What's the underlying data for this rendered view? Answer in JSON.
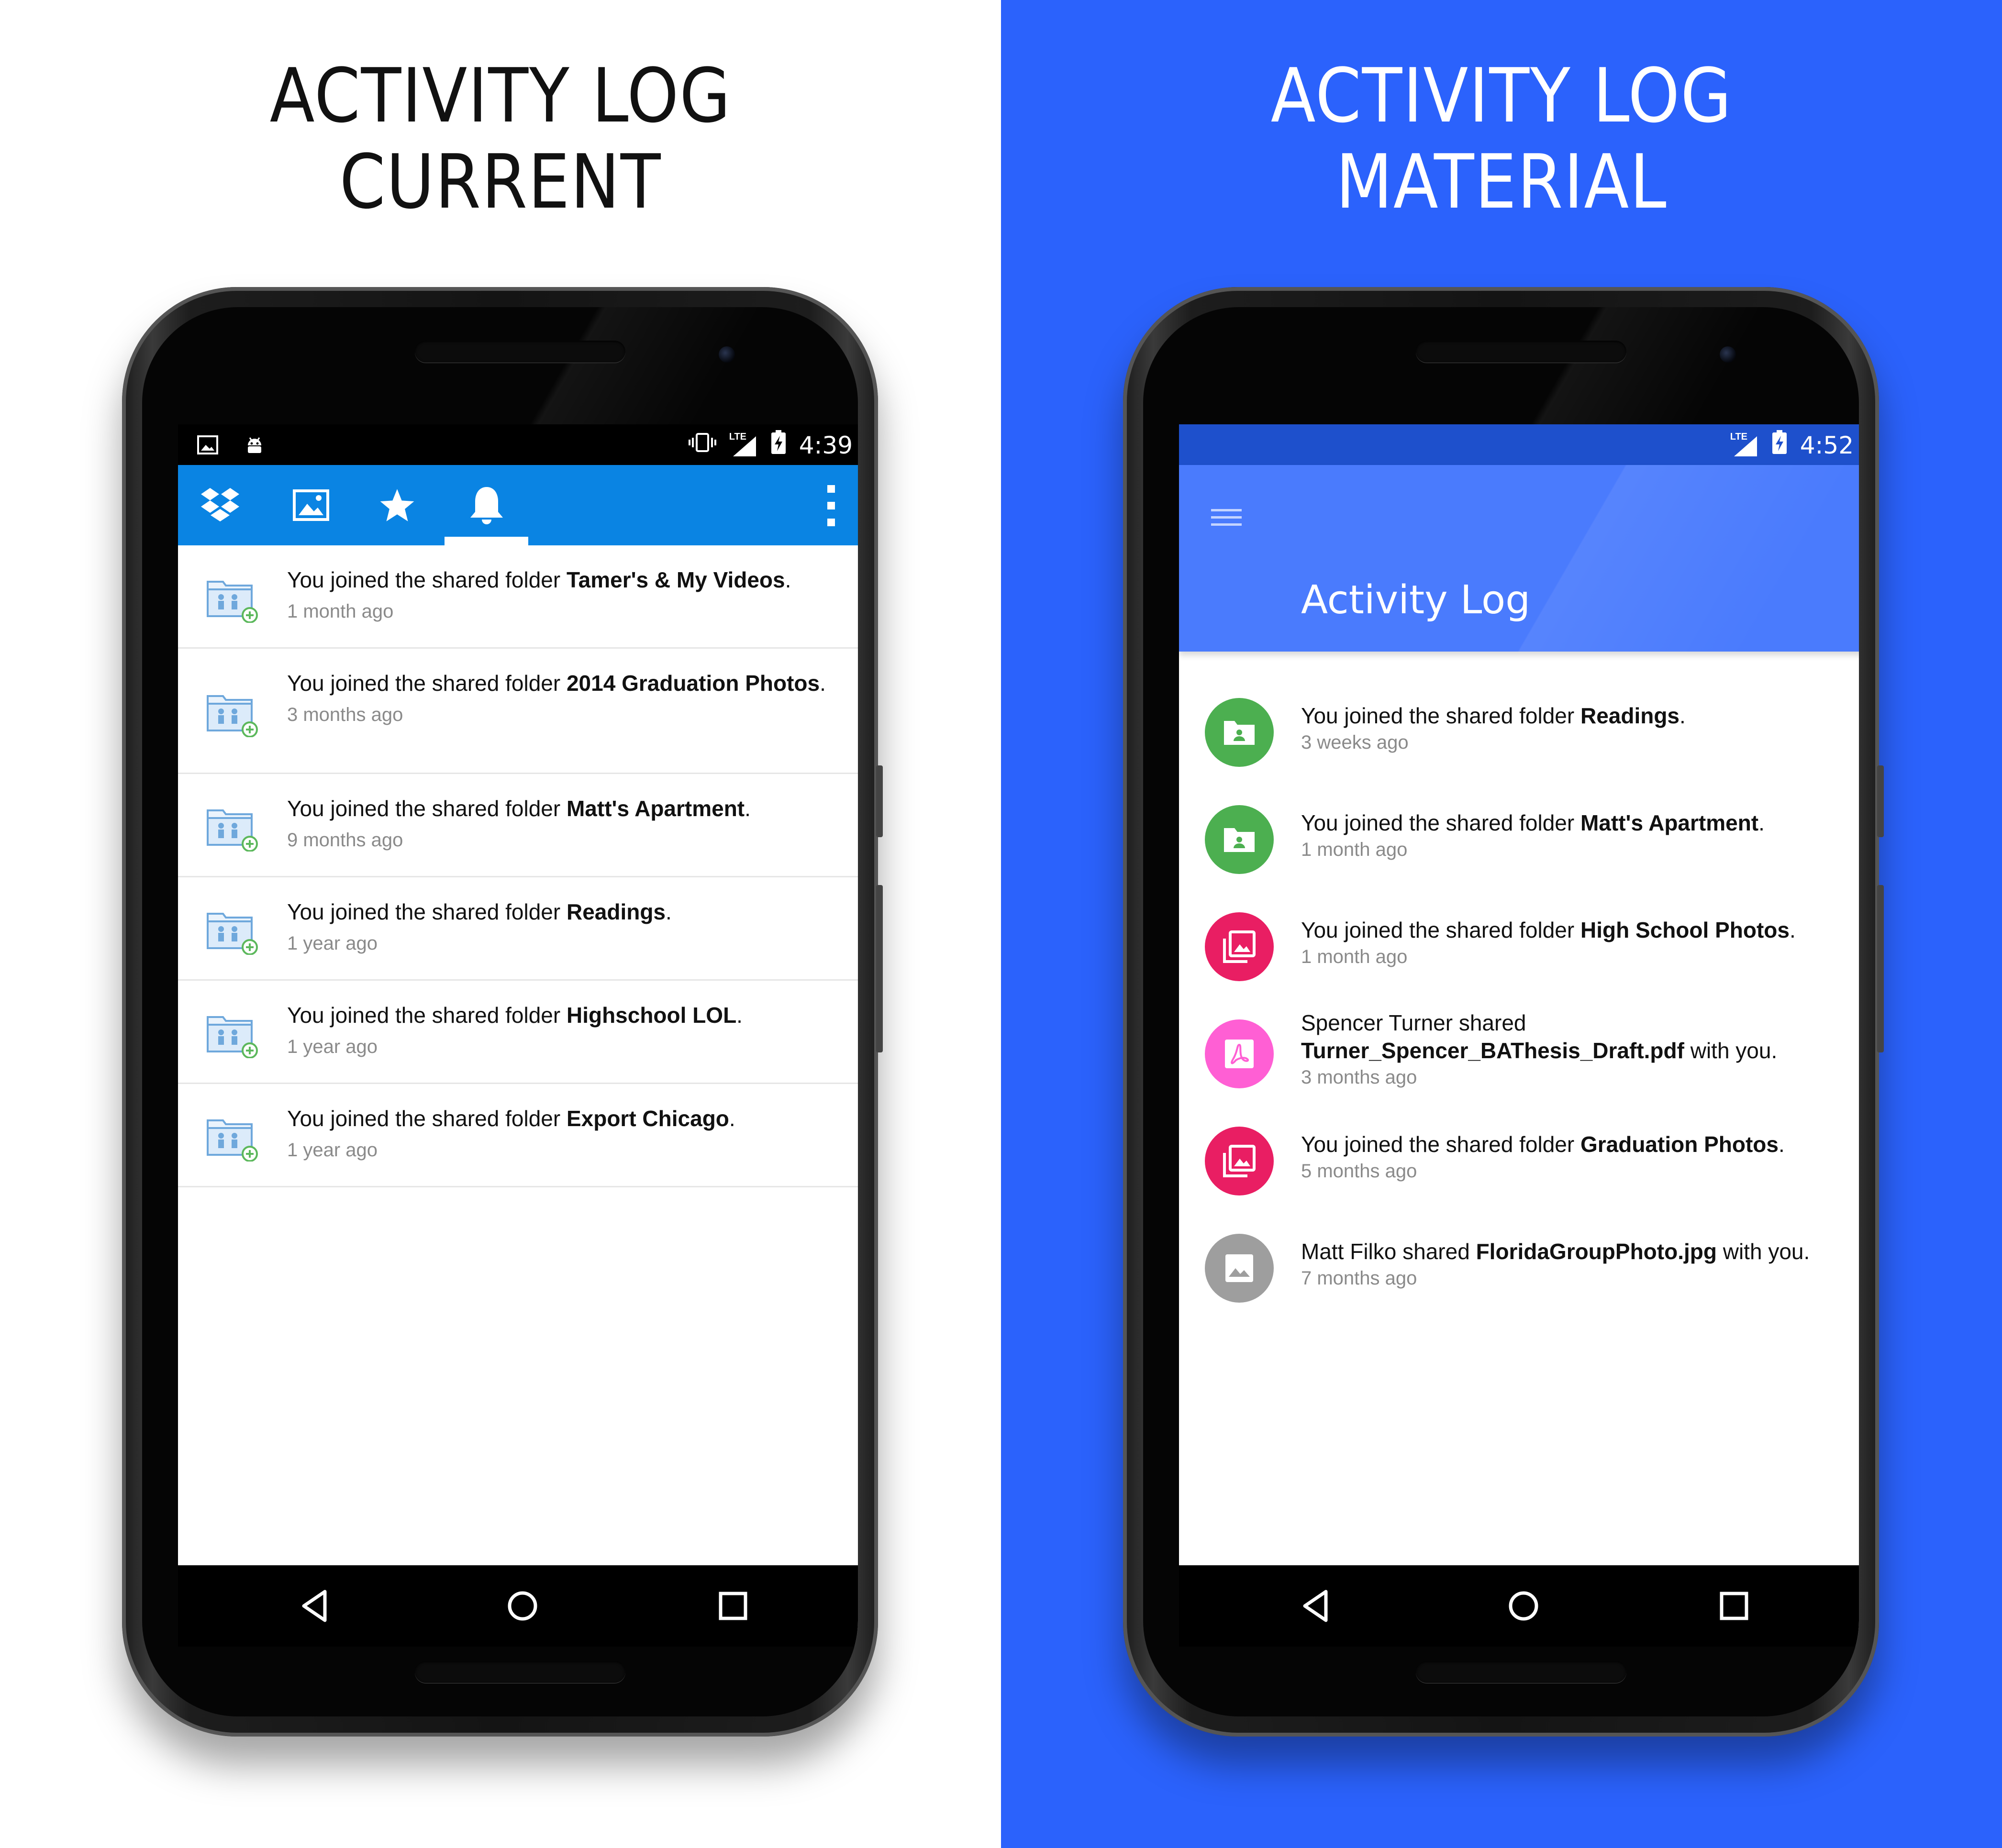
{
  "left": {
    "headline": [
      "ACTIVITY LOG",
      "CURRENT"
    ],
    "status_time": "4:39",
    "status_network": "LTE",
    "tabs": [
      {
        "icon": "dropbox-icon"
      },
      {
        "icon": "photos-icon"
      },
      {
        "icon": "star-icon"
      },
      {
        "icon": "bell-icon",
        "active": true
      }
    ],
    "items": [
      {
        "prefix": "You joined the shared folder ",
        "name": "Tamer's & My Videos",
        "suffix": ".",
        "time": "1 month ago"
      },
      {
        "prefix": "You joined the shared folder ",
        "name": "2014 Graduation Photos",
        "suffix": ".",
        "time": "3 months ago"
      },
      {
        "prefix": "You joined the shared folder ",
        "name": "Matt's Apartment",
        "suffix": ".",
        "time": "9 months ago"
      },
      {
        "prefix": "You joined the shared folder ",
        "name": "Readings",
        "suffix": ".",
        "time": "1 year ago"
      },
      {
        "prefix": "You joined the shared folder ",
        "name": "Highschool LOL",
        "suffix": ".",
        "time": "1 year ago"
      },
      {
        "prefix": "You joined the shared folder ",
        "name": "Export Chicago",
        "suffix": ".",
        "time": "1 year ago"
      }
    ]
  },
  "right": {
    "headline": [
      "ACTIVITY LOG",
      "MATERIAL"
    ],
    "status_time": "4:52",
    "status_network": "LTE",
    "title": "Activity Log",
    "items": [
      {
        "icon": "shared-folder-icon",
        "color": "#4caf50",
        "prefix": "You joined the shared folder ",
        "name": "Readings",
        "suffix": ".",
        "time": "3 weeks ago"
      },
      {
        "icon": "shared-folder-icon",
        "color": "#4caf50",
        "prefix": "You joined the shared folder ",
        "name": "Matt's Apartment",
        "suffix": ".",
        "time": "1 month ago"
      },
      {
        "icon": "photo-library-icon",
        "color": "#e91e63",
        "prefix": "You joined the shared folder ",
        "name": "High School Photos",
        "suffix": ".",
        "time": "1 month ago"
      },
      {
        "icon": "pdf-icon",
        "color": "#ff5fd4",
        "prefix": "Spencer Turner shared ",
        "name": "Turner_Spencer_BAThesis_Draft.pdf",
        "suffix": " with you.",
        "time": "3 months ago"
      },
      {
        "icon": "photo-library-icon",
        "color": "#e91e63",
        "prefix": "You joined the shared folder ",
        "name": "Graduation Photos",
        "suffix": ".",
        "time": "5 months ago"
      },
      {
        "icon": "image-icon",
        "color": "#9e9e9e",
        "prefix": "Matt Filko shared ",
        "name": "FloridaGroupPhoto.jpg",
        "suffix": " with you.",
        "time": "7 months ago"
      }
    ]
  },
  "colors": {
    "right_background": "#2b62fc",
    "left_tabbar": "#0a84e3",
    "right_appbar": "#4a7bfd",
    "right_statusbar": "#1e50cc"
  }
}
